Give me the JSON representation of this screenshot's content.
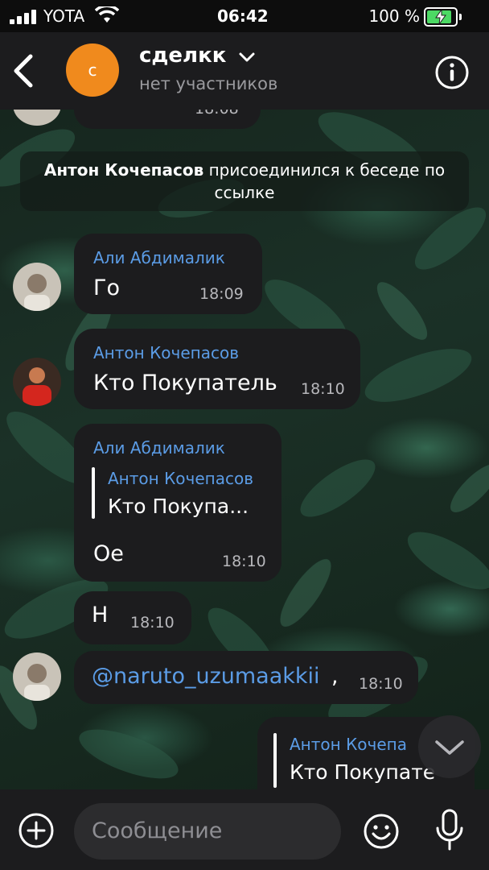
{
  "status_bar": {
    "carrier": "YOTA",
    "time": "06:42",
    "battery_text": "100 %"
  },
  "header": {
    "avatar_letter": "с",
    "title": "сделкк",
    "subtitle": "нет участников"
  },
  "messages": {
    "partial_top_time": "18:08",
    "system": {
      "name": "Антон Кочепасов",
      "text": "присоединился к беседе по ссылке"
    },
    "m1": {
      "sender": "Али Абдималик",
      "text": "Го",
      "time": "18:09"
    },
    "m2": {
      "sender": "Антон Кочепасов",
      "text": "Кто Покупатель",
      "time": "18:10"
    },
    "m3": {
      "sender": "Али Абдималик",
      "quote_sender": "Антон Кочепасов",
      "quote_text": "Кто Покупа...",
      "text": "Ое",
      "time": "18:10"
    },
    "m4": {
      "text": "Н",
      "time": "18:10"
    },
    "m5": {
      "mention": "@naruto_uzumaakkii",
      "suffix": ",",
      "time": "18:10"
    },
    "m6": {
      "quote_sender": "Антон Кочепа",
      "quote_text": "Кто Покупате"
    }
  },
  "input": {
    "placeholder": "Сообщение"
  },
  "colors": {
    "accent_blue": "#5b9ce6",
    "bubble": "#1c1c1e",
    "header": "#1c1c1e",
    "avatar_orange": "#f08a1d",
    "battery_green": "#4cd964"
  },
  "icons": [
    "signal-icon",
    "wifi-icon",
    "battery-icon",
    "back-arrow-icon",
    "chevron-down-icon",
    "info-icon",
    "plus-icon",
    "emoji-icon",
    "microphone-icon",
    "scroll-down-icon"
  ]
}
